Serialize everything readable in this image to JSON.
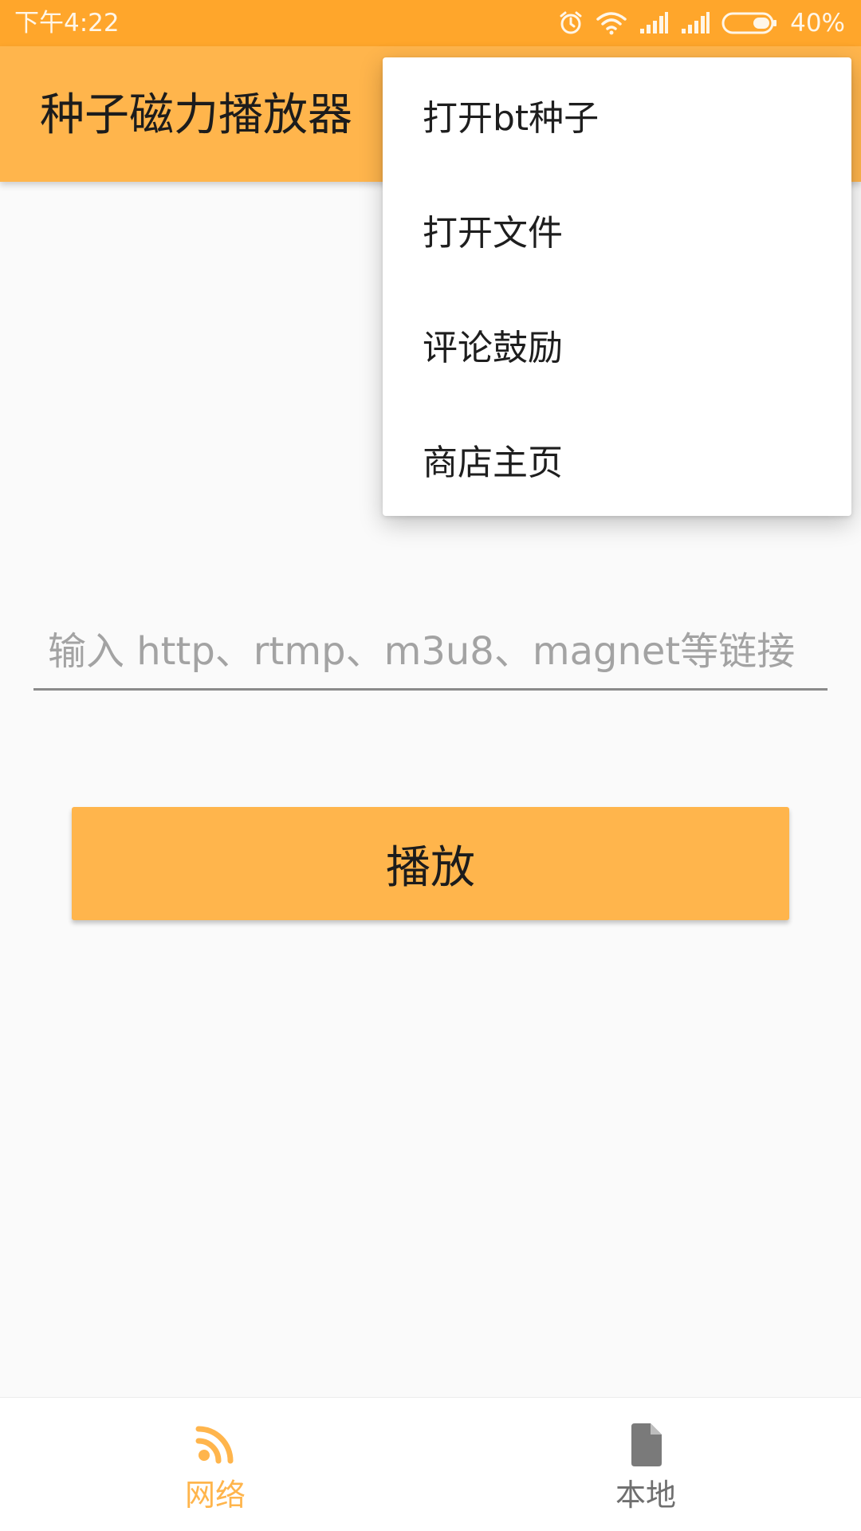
{
  "status_bar": {
    "time": "下午4:22",
    "battery": "40%"
  },
  "app_bar": {
    "title": "种子磁力播放器"
  },
  "menu": {
    "items": [
      {
        "label": "打开bt种子"
      },
      {
        "label": "打开文件"
      },
      {
        "label": "评论鼓励"
      },
      {
        "label": "商店主页"
      }
    ]
  },
  "url_input": {
    "value": "",
    "placeholder": "输入 http、rtmp、m3u8、magnet等链接"
  },
  "play_button": {
    "label": "播放"
  },
  "bottom_nav": {
    "items": [
      {
        "label": "网络",
        "icon": "rss-feed-icon",
        "active": true
      },
      {
        "label": "本地",
        "icon": "file-icon",
        "active": false
      }
    ]
  },
  "colors": {
    "status_bar": "#ffa62b",
    "accent": "#ffb54c",
    "background": "#fafafa",
    "inactive": "#6f6f6f"
  }
}
